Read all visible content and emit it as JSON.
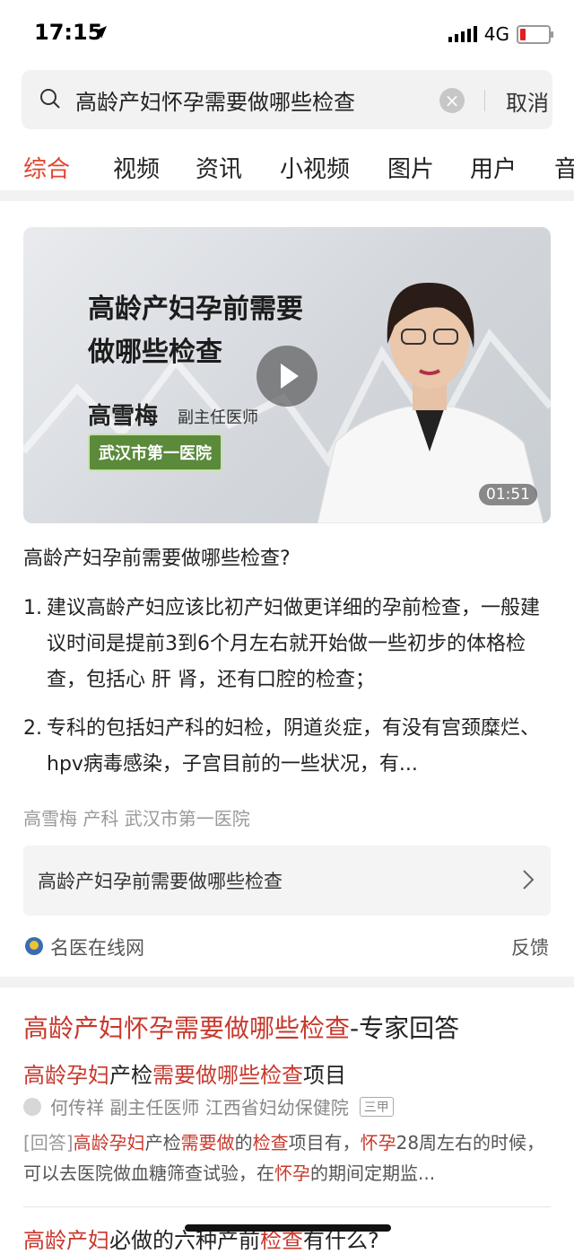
{
  "status_bar": {
    "time": "17:15",
    "network": "4G"
  },
  "search": {
    "query": "高龄产妇怀孕需要做哪些检查",
    "cancel_label": "取消"
  },
  "tabs": [
    {
      "label": "综合",
      "active": true
    },
    {
      "label": "视频"
    },
    {
      "label": "资讯"
    },
    {
      "label": "小视频"
    },
    {
      "label": "图片"
    },
    {
      "label": "用户"
    },
    {
      "label": "音"
    }
  ],
  "video": {
    "title_line1": "高龄产妇孕前需要",
    "title_line2": "做哪些检查",
    "doctor_name": "高雪梅",
    "doctor_role": "副主任医师",
    "hospital": "武汉市第一医院",
    "duration": "01:51"
  },
  "result1": {
    "question": "高龄产妇孕前需要做哪些检查?",
    "answers": [
      {
        "num": "1.",
        "text": "建议高龄产妇应该比初产妇做更详细的孕前检查，一般建议时间是提前3到6个月左右就开始做一些初步的体格检查，包括心 肝 肾，还有口腔的检查；"
      },
      {
        "num": "2.",
        "text": "专科的包括妇产科的妇检，阴道炎症，有没有宫颈糜烂、hpv病毒感染，子宫目前的一些状况，有..."
      }
    ],
    "meta": "高雪梅 产科 武汉市第一医院",
    "link_text": "高龄产妇孕前需要做哪些检查",
    "source": "名医在线网",
    "feedback": "反馈"
  },
  "result2": {
    "title_red": "高龄产妇怀孕需要做哪些检查",
    "title_rest": "-专家回答",
    "sub": [
      {
        "t": "高龄孕妇",
        "red": true
      },
      {
        "t": "产检",
        "red": false
      },
      {
        "t": "需要做哪些检查",
        "red": true
      },
      {
        "t": "项目",
        "red": false
      }
    ],
    "author": "何传祥 副主任医师 江西省妇幼保健院",
    "badge": "三甲",
    "answer": [
      {
        "t": "[回答]",
        "red": false
      },
      {
        "t": "高龄孕妇",
        "red": true
      },
      {
        "t": "产检",
        "red": false
      },
      {
        "t": "需要做",
        "red": true
      },
      {
        "t": "的",
        "red": false
      },
      {
        "t": "检查",
        "red": true
      },
      {
        "t": "项目有，",
        "red": false
      },
      {
        "t": "怀孕",
        "red": true
      },
      {
        "t": "28周左右的时候，可以去医院做血糖筛查试验，在",
        "red": false
      },
      {
        "t": "怀孕",
        "red": true
      },
      {
        "t": "的期间定期监...",
        "red": false
      }
    ]
  },
  "result3": {
    "title": [
      {
        "t": "高龄产妇",
        "red": true
      },
      {
        "t": "必做的六种产前",
        "red": false
      },
      {
        "t": "检查",
        "red": true
      },
      {
        "t": "有什么?",
        "red": false
      }
    ]
  },
  "colors": {
    "accent": "#e0452f",
    "highlight": "#c8382c",
    "hospital_badge": "#5a8a3a"
  }
}
